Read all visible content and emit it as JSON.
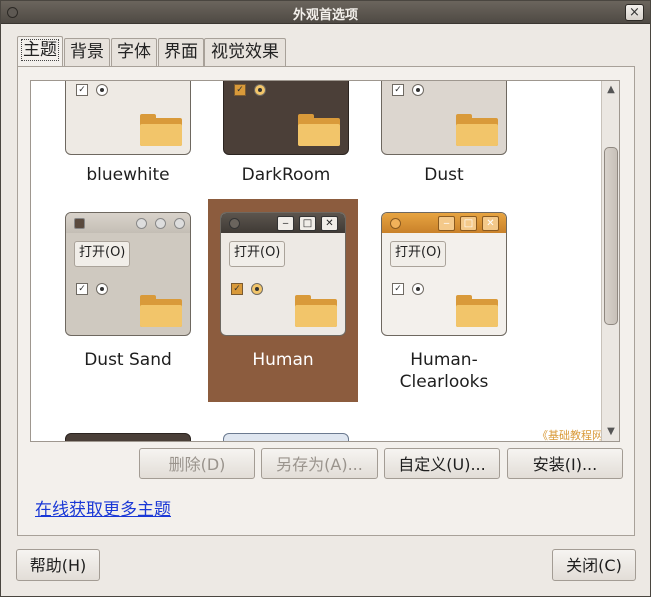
{
  "window": {
    "title": "外观首选项",
    "close_glyph": "×"
  },
  "tabs": [
    {
      "label": "主题",
      "active": true
    },
    {
      "label": "背景",
      "active": false
    },
    {
      "label": "字体",
      "active": false
    },
    {
      "label": "界面",
      "active": false
    },
    {
      "label": "视觉效果",
      "active": false
    }
  ],
  "themes": [
    {
      "name": "bluewhite",
      "selected": false
    },
    {
      "name": "DarkRoom",
      "selected": false
    },
    {
      "name": "Dust",
      "selected": false
    },
    {
      "name": "Dust Sand",
      "selected": false
    },
    {
      "name": "Human",
      "selected": true
    },
    {
      "name": "Human-Clearlooks",
      "selected": false
    }
  ],
  "preview": {
    "open_button": "打开(O)",
    "checkbox_mark": "✓",
    "minimize": "‒",
    "maximize": "□",
    "close": "✕"
  },
  "watermark": "《基础教程网》",
  "actions": {
    "delete": "删除(D)",
    "save_as": "另存为(A)...",
    "customize": "自定义(U)...",
    "install": "安装(I)..."
  },
  "more_themes_link": "在线获取更多主题",
  "footer": {
    "help": "帮助(H)",
    "close": "关闭(C)"
  },
  "scrollbar": {
    "up": "▲",
    "down": "▼"
  },
  "colors": {
    "selection": "#8c5c3e",
    "link": "#1a38d6",
    "accent": "#d99a3a"
  }
}
